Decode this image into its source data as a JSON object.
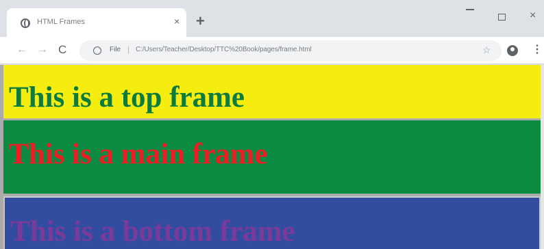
{
  "browser": {
    "tab": {
      "title": "HTML Frames",
      "close_glyph": "×",
      "favicon_icon": "globe-icon"
    },
    "new_tab_glyph": "+",
    "window_controls": {
      "minimize_icon": "minimize-icon",
      "maximize_icon": "maximize-icon",
      "close_glyph": "×"
    },
    "toolbar": {
      "back_glyph": "←",
      "forward_glyph": "→",
      "reload_glyph": "C",
      "url_scheme": "File",
      "url_separator": "|",
      "url": "C:/Users/Teacher/Desktop/TTC%20Book/pages/frame.html",
      "star_glyph": "☆",
      "menu_glyph": "⋮"
    }
  },
  "frames": {
    "top": {
      "text": "This is a top frame",
      "background": "#f5ec10",
      "text_color": "#0b7b3e"
    },
    "main": {
      "text": "This is a main frame",
      "background": "#0b8a42",
      "text_color": "#ee1c24"
    },
    "bottom": {
      "text": "This is a bottom frame",
      "background": "#324da0",
      "text_color": "#7a3a9a"
    }
  }
}
